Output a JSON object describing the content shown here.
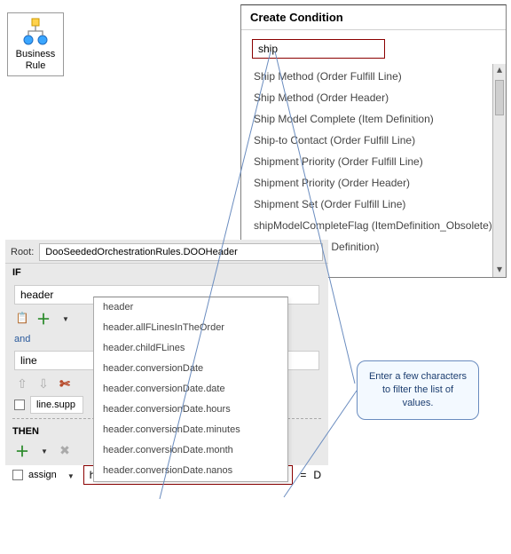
{
  "biz_rule": {
    "label": "Business Rule"
  },
  "create_condition": {
    "title": "Create Condition",
    "input_value": "ship",
    "list": [
      "Ship Method (Order Fulfill Line)",
      "Ship Method (Order Header)",
      "Ship Model Complete (Item Definition)",
      "Ship-to Contact (Order Fulfill Line)",
      "Shipment Priority (Order Fulfill Line)",
      "Shipment Priority (Order Header)",
      "Shipment Set (Order Fulfill Line)",
      "shipModelCompleteFlag (ItemDefinition_Obsolete)",
      "Shippable (Item Definition)"
    ]
  },
  "rules": {
    "root_label": "Root:",
    "root_value": "DooSeededOrchestrationRules.DOOHeader",
    "if_label": "IF",
    "header_field": "header",
    "and_label": "and",
    "line_field": "line",
    "line_supp": "line.supp",
    "then_label": "THEN",
    "assign_label": "assign",
    "assign_value": "header.",
    "eq": "=",
    "d_label": "D"
  },
  "left_dropdown": [
    "header",
    "header.allFLinesInTheOrder",
    "header.childFLines",
    "header.conversionDate",
    "header.conversionDate.date",
    "header.conversionDate.hours",
    "header.conversionDate.minutes",
    "header.conversionDate.month",
    "header.conversionDate.nanos"
  ],
  "callout": "Enter a few characters to filter the list of values."
}
